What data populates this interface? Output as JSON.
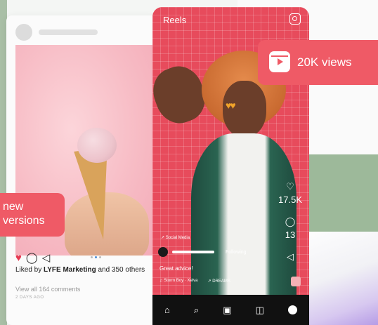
{
  "post": {
    "liked_prefix": "Liked by ",
    "liked_brand": "LYFE Marketing",
    "liked_suffix": " and 350 others",
    "comments": "View all 164 comments",
    "ago": "2 DAYS AGO"
  },
  "badge_left": {
    "line1": "new",
    "line2": "versions"
  },
  "reels": {
    "title": "Reels",
    "hashtag": "↗ Social Media",
    "follow": "Following",
    "caption": "Great advice!",
    "music_left": "♫ Storm Boy · Xelva",
    "music_right": "↗ DREAMS",
    "side_labels": [
      "17.5K",
      "13",
      ""
    ],
    "nav_icons": [
      "home-icon",
      "search-icon",
      "reels-icon",
      "shop-icon",
      "profile-icon"
    ]
  },
  "badge_right": {
    "text": "20K views"
  },
  "colors": {
    "accent": "#ef5a66",
    "reels_bg": "#e74b5c"
  }
}
